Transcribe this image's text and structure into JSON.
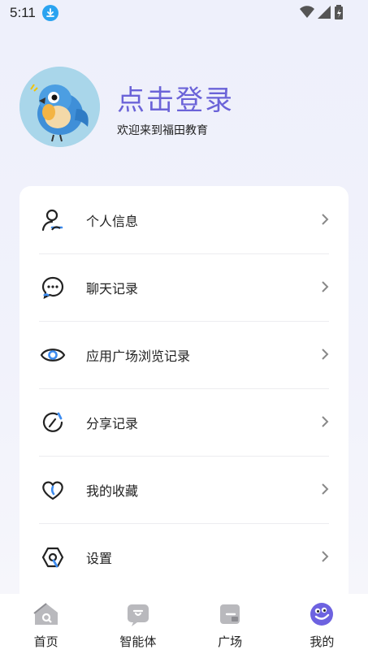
{
  "status_bar": {
    "time": "5:11"
  },
  "profile": {
    "login_label": "点击登录",
    "welcome_text": "欢迎来到福田教育"
  },
  "menu": {
    "items": [
      {
        "label": "个人信息",
        "icon": "person-icon"
      },
      {
        "label": "聊天记录",
        "icon": "chat-bubble-icon"
      },
      {
        "label": "应用广场浏览记录",
        "icon": "eye-icon"
      },
      {
        "label": "分享记录",
        "icon": "share-circle-icon"
      },
      {
        "label": "我的收藏",
        "icon": "heart-icon"
      },
      {
        "label": "设置",
        "icon": "settings-hexagon-icon"
      }
    ]
  },
  "tabbar": {
    "tabs": [
      {
        "label": "首页",
        "icon": "home-icon",
        "active": false
      },
      {
        "label": "智能体",
        "icon": "agent-icon",
        "active": false
      },
      {
        "label": "广场",
        "icon": "plaza-icon",
        "active": false
      },
      {
        "label": "我的",
        "icon": "profile-face-icon",
        "active": true
      }
    ]
  },
  "colors": {
    "accent": "#6b63d8",
    "blue_accent": "#3d8cf0",
    "background": "#eef0fb"
  }
}
